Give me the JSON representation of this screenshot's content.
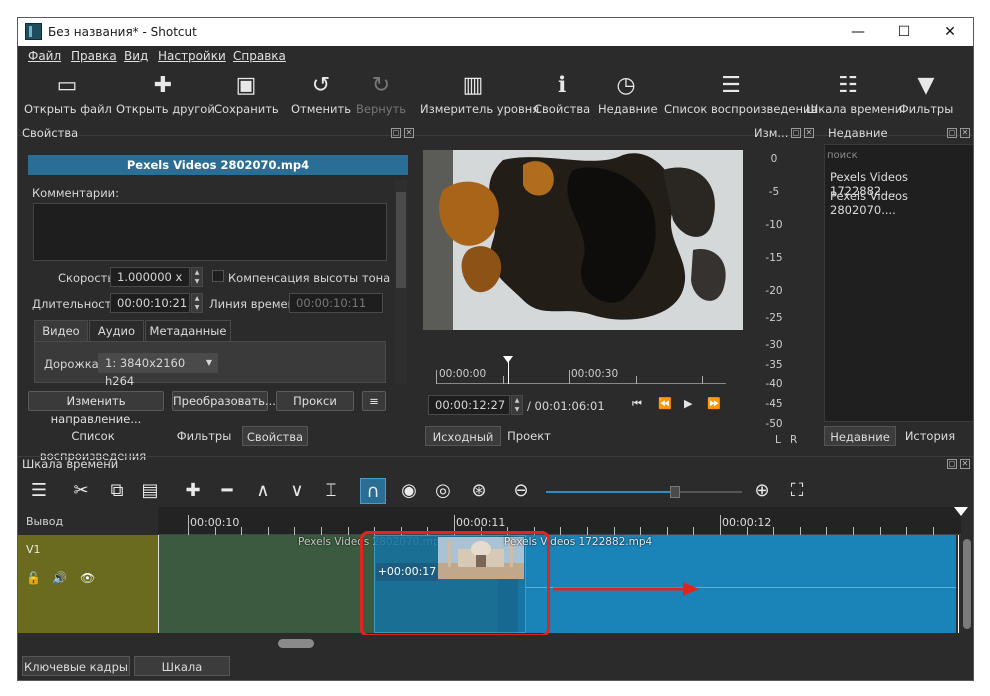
{
  "window": {
    "title": "Без названия* - Shotcut"
  },
  "menu": [
    "Файл",
    "Правка",
    "Вид",
    "Настройки",
    "Справка"
  ],
  "toolbar": [
    {
      "label": "Открыть файл",
      "icon": "folder-open-icon"
    },
    {
      "label": "Открыть другой",
      "icon": "open-other-icon"
    },
    {
      "label": "Сохранить",
      "icon": "save-icon"
    },
    {
      "label": "Отменить",
      "icon": "undo-icon"
    },
    {
      "label": "Вернуть",
      "icon": "redo-icon"
    },
    {
      "label": "Измеритель уровня",
      "icon": "level-meter-icon"
    },
    {
      "label": "Свойства",
      "icon": "info-icon"
    },
    {
      "label": "Недавние",
      "icon": "clock-icon"
    },
    {
      "label": "Список воспроизведения",
      "icon": "list-icon"
    },
    {
      "label": "Шкала времени",
      "icon": "timeline-icon"
    },
    {
      "label": "Фильтры",
      "icon": "filter-icon"
    }
  ],
  "properties": {
    "header": "Свойства",
    "clip_name": "Pexels Videos 2802070.mp4",
    "comments_label": "Комментарии:",
    "speed_label": "Скорость",
    "speed_value": "1.000000 x",
    "pitch_label": "Компенсация высоты тона",
    "duration_label": "Длительность",
    "duration_value": "00:00:10:21",
    "timeline_label": "Линия времени",
    "timeline_value": "00:00:10:11",
    "tabs": [
      "Видео",
      "Аудио",
      "Метаданные"
    ],
    "track_label": "Дорожка",
    "track_value": "1: 3840x2160 h264",
    "buttons": [
      "Изменить направление...",
      "Преобразовать...",
      "Прокси"
    ],
    "more_button": "≡"
  },
  "left_bottom_tabs": [
    "Список воспроизведения",
    "Фильтры",
    "Свойства"
  ],
  "player": {
    "ruler": [
      "00:00:00",
      "00:00:30"
    ],
    "current_time": "00:00:12:27",
    "total_time": "/ 00:01:06:01",
    "tabs": [
      "Исходный",
      "Проект"
    ]
  },
  "meter": {
    "header": "Изм...",
    "scale": [
      "0",
      "-5",
      "-10",
      "-15",
      "-20",
      "-25",
      "-30",
      "-35",
      "-40",
      "-45",
      "-50"
    ],
    "channels": [
      "L",
      "R"
    ]
  },
  "recent": {
    "header": "Недавние",
    "search_placeholder": "поиск",
    "items": [
      "Pexels Videos 1722882....",
      "Pexels Videos 2802070...."
    ],
    "tabs": [
      "Недавние",
      "История"
    ]
  },
  "timeline": {
    "header": "Шкала времени",
    "output_label": "Вывод",
    "track_name": "V1",
    "ruler": [
      "00:00:10",
      "00:00:11",
      "00:00:12"
    ],
    "clip1_name": "Pexels Videos 2802070.mp4",
    "clip2_name": "Pexels Videos 1722882.mp4",
    "drag_offset": "+00:00:17",
    "bottom_tabs": [
      "Ключевые кадры",
      "Шкала времени"
    ]
  },
  "colors": {
    "bg": "#2b2b2b",
    "highlight": "#2a6e96",
    "clip": "#1a84b8",
    "annotation_red": "#e0251f"
  }
}
